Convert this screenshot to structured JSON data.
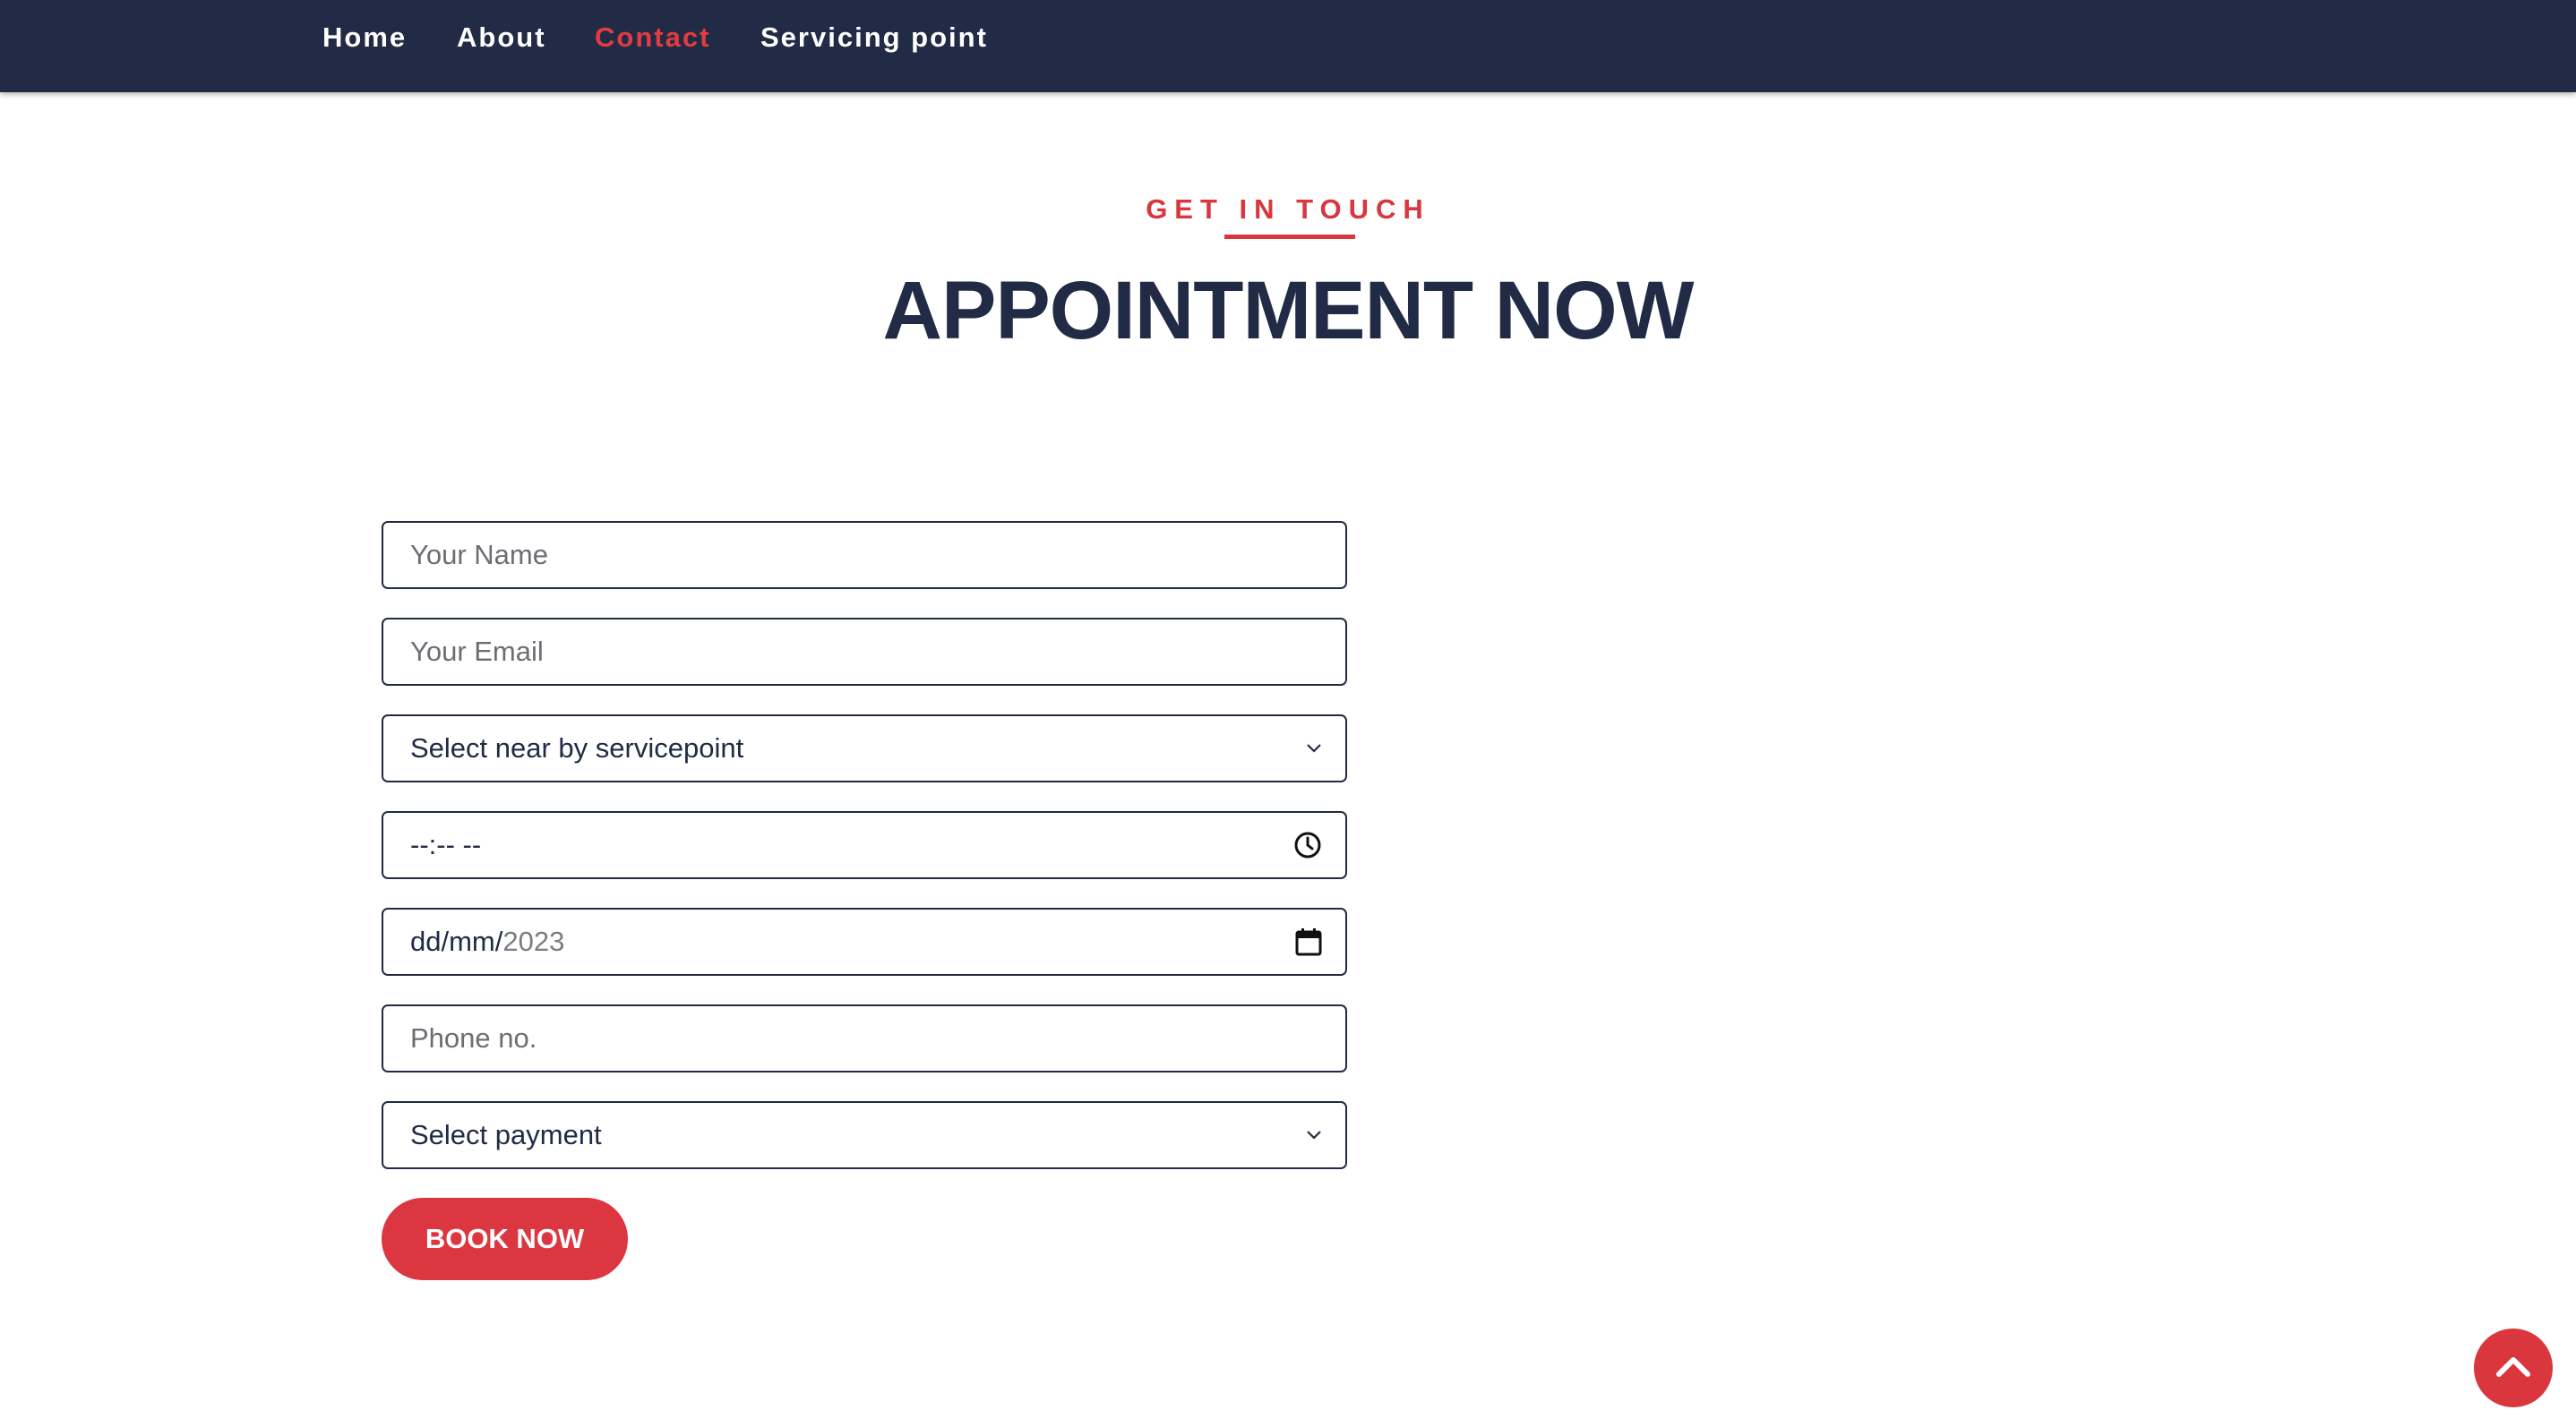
{
  "nav": {
    "items": [
      {
        "label": "Home"
      },
      {
        "label": "About"
      },
      {
        "label": "Contact"
      },
      {
        "label": "Servicing point"
      }
    ]
  },
  "header": {
    "eyebrow": "GET IN TOUCH",
    "title": "APPOINTMENT NOW"
  },
  "form": {
    "name_placeholder": "Your Name",
    "email_placeholder": "Your Email",
    "servicepoint_selected": "Select near by servicepoint",
    "time_value": "--:-- --",
    "date_prefix": "dd/mm/",
    "date_year": "2023",
    "phone_placeholder": "Phone no.",
    "payment_selected": "Select payment",
    "submit_label": "BOOK NOW"
  },
  "icons": {
    "clock": "clock-icon",
    "calendar": "calendar-icon",
    "chevron": "chevron-down-icon",
    "scroll_top": "chevron-up-icon"
  },
  "colors": {
    "navy": "#222b45",
    "accent": "#d9363e",
    "white": "#ffffff"
  }
}
